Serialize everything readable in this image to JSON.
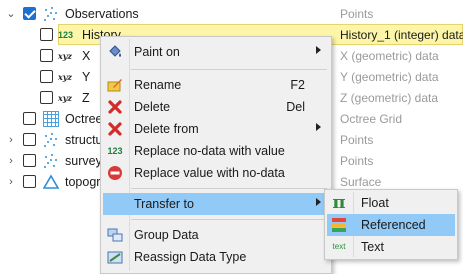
{
  "tree": {
    "rows": [
      {
        "label": "Observations",
        "type": "Points",
        "icon": "points-icon",
        "checked": true
      },
      {
        "label": "History",
        "type": "History_1 (integer) data",
        "icon": "integer-icon",
        "badge": "123"
      },
      {
        "label": "X",
        "type": "X (geometric) data",
        "icon": "xyz-icon",
        "badge": "xyz"
      },
      {
        "label": "Y",
        "type": "Y (geometric) data",
        "icon": "xyz-icon",
        "badge": "xyz"
      },
      {
        "label": "Z",
        "type": "Z (geometric) data",
        "icon": "xyz-icon",
        "badge": "xyz"
      },
      {
        "label": "Octree",
        "type": "Octree Grid",
        "icon": "octree-grid-icon"
      },
      {
        "label": "structu",
        "type": "Points",
        "icon": "points-icon"
      },
      {
        "label": "survey",
        "type": "Points",
        "icon": "points-icon"
      },
      {
        "label": "topogr",
        "type": "Surface",
        "icon": "surface-icon"
      }
    ]
  },
  "context_menu": {
    "items": [
      {
        "label": "Paint on",
        "icon": "paint-bucket-icon",
        "submenu": true
      },
      {
        "label": "Rename",
        "shortcut": "F2",
        "icon": "rename-icon"
      },
      {
        "label": "Delete",
        "shortcut": "Del",
        "icon": "delete-icon"
      },
      {
        "label": "Delete from",
        "icon": "delete-from-icon",
        "submenu": true
      },
      {
        "label": "Replace no-data with value",
        "icon": "integer-icon",
        "badge": "123"
      },
      {
        "label": "Replace value with no-data",
        "icon": "no-entry-icon"
      },
      {
        "label": "Transfer to",
        "icon": "",
        "submenu": true,
        "active": true
      },
      {
        "label": "Group Data",
        "icon": "group-data-icon"
      },
      {
        "label": "Reassign Data Type",
        "icon": "reassign-icon"
      }
    ]
  },
  "transfer_submenu": {
    "items": [
      {
        "label": "Float",
        "icon": "pi-icon",
        "glyph": "π"
      },
      {
        "label": "Referenced",
        "icon": "referenced-icon",
        "active": true
      },
      {
        "label": "Text",
        "icon": "text-icon",
        "badge": "text"
      }
    ]
  },
  "colors": {
    "selection": "#fdf6a8",
    "menu_highlight": "#91c9f7",
    "accent": "#1d6fd6"
  }
}
